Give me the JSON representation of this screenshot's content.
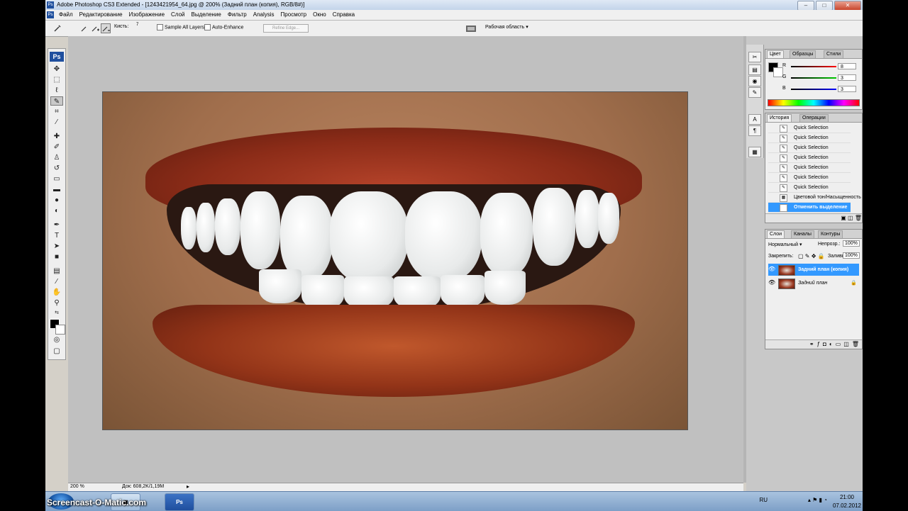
{
  "window": {
    "title": "Adobe Photoshop CS3 Extended - [1243421954_64.jpg @ 200% (Задний план (копия), RGB/8#)]",
    "app_icon": "Ps"
  },
  "menu": {
    "items": [
      "Файл",
      "Редактирование",
      "Изображение",
      "Слой",
      "Выделение",
      "Фильтр",
      "Analysis",
      "Просмотр",
      "Окно",
      "Справка"
    ]
  },
  "options_bar": {
    "brush_label": "Кисть:",
    "brush_size": "7",
    "sample_all_layers": "Sample All Layers",
    "auto_enhance": "Auto-Enhance",
    "refine_edge": "Refine Edge...",
    "workspace": "Рабочая область"
  },
  "toolbox": {
    "logo": "Ps",
    "tools": [
      "move-icon",
      "marquee-icon",
      "lasso-icon",
      "quick-selection-icon",
      "crop-icon",
      "eyedropper-icon",
      "healing-icon",
      "brush-icon",
      "stamp-icon",
      "history-brush-icon",
      "eraser-icon",
      "gradient-icon",
      "blur-icon",
      "dodge-icon",
      "pen-icon",
      "type-icon",
      "path-select-icon",
      "shape-icon",
      "notes-icon",
      "eyedropper2-icon",
      "hand-icon",
      "zoom-icon"
    ]
  },
  "status": {
    "zoom": "200 %",
    "doc": "Док: 608,2K/1,19M"
  },
  "color_panel": {
    "tabs": [
      "Цвет",
      "Образцы",
      "Стили"
    ],
    "r_label": "R",
    "r_value": "8",
    "g_label": "G",
    "g_value": "3",
    "b_label": "B",
    "b_value": "3"
  },
  "history_panel": {
    "tabs": [
      "История",
      "Операции"
    ],
    "items": [
      "Quick Selection",
      "Quick Selection",
      "Quick Selection",
      "Quick Selection",
      "Quick Selection",
      "Quick Selection",
      "Quick Selection",
      "Цветовой тон/Насыщенность",
      "Отменить выделение"
    ]
  },
  "layers_panel": {
    "tabs": [
      "Слои",
      "Каналы",
      "Контуры"
    ],
    "blend_mode": "Нормальный",
    "opacity_label": "Непрозр.:",
    "opacity_value": "100%",
    "lock_label": "Закрепить:",
    "fill_label": "Заливка:",
    "fill_value": "100%",
    "layers": [
      "Задний план (копия)",
      "Задний план"
    ]
  },
  "taskbar": {
    "watermark": "Screencast-O-Matic.com",
    "ps_button": "Ps",
    "lang": "RU",
    "time": "21:00",
    "date": "07.02.2012"
  }
}
